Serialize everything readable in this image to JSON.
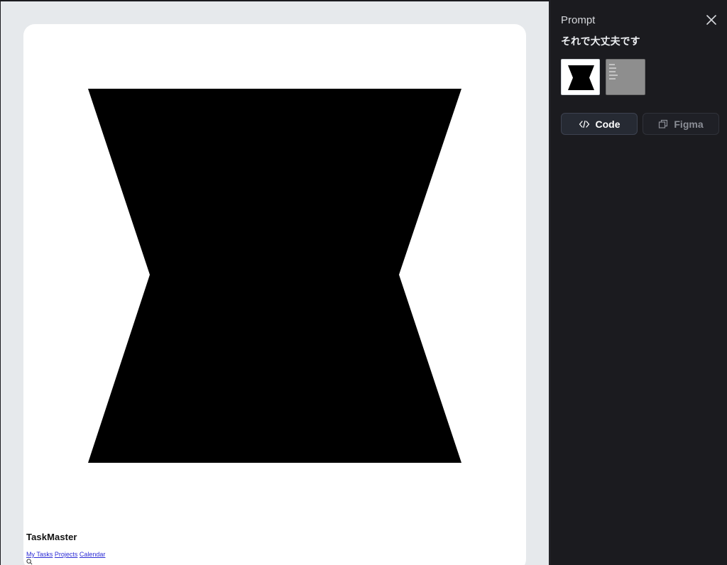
{
  "preview": {
    "brand": "TaskMaster",
    "nav": [
      "My Tasks",
      "Projects",
      "Calendar"
    ],
    "icons": {
      "shape": "hourglass-shape",
      "search": "search-icon"
    }
  },
  "panel": {
    "title": "Prompt",
    "prompt_text": "それで大丈夫です",
    "thumbnails": [
      "thumbnail-hourglass",
      "thumbnail-document"
    ],
    "buttons": {
      "code_label": "Code",
      "figma_label": "Figma"
    },
    "icons": {
      "close": "close-icon",
      "code": "code-icon",
      "figma": "figma-icon"
    }
  },
  "colors": {
    "preview_bg": "#e6e9ec",
    "panel_bg": "#1b1b1f",
    "link": "#2c2cd6",
    "shape": "#000000"
  }
}
